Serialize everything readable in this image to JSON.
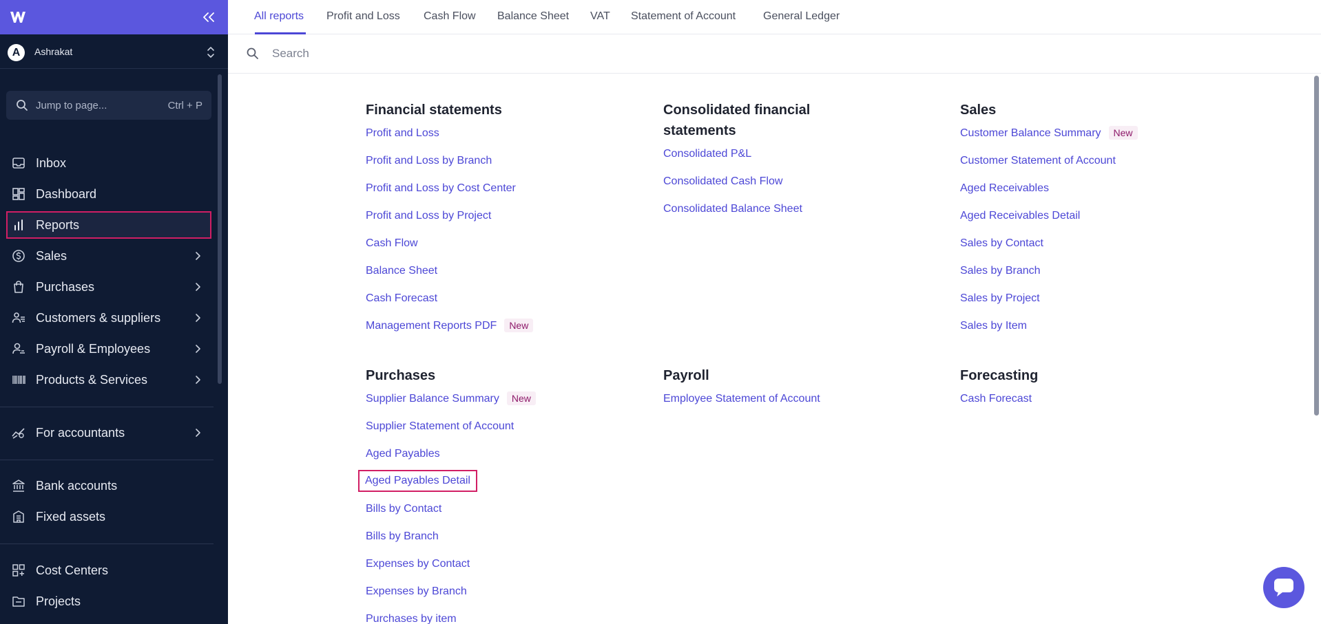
{
  "sidebar": {
    "org": {
      "initial": "A",
      "name": "Ashrakat"
    },
    "jump": {
      "label": "Jump to page...",
      "shortcut": "Ctrl + P"
    },
    "items": [
      {
        "label": "Inbox",
        "icon": "inbox-icon"
      },
      {
        "label": "Dashboard",
        "icon": "dashboard-icon"
      },
      {
        "label": "Reports",
        "icon": "bar-chart-icon",
        "active": true
      },
      {
        "label": "Sales",
        "icon": "dollar-circle-icon"
      },
      {
        "label": "Purchases",
        "icon": "shopping-bag-icon"
      },
      {
        "label": "Customers & suppliers",
        "icon": "users-icon"
      },
      {
        "label": "Payroll & Employees",
        "icon": "payroll-icon"
      },
      {
        "label": "Products & Services",
        "icon": "barcode-icon"
      },
      {
        "label": "For accountants",
        "icon": "trend-icon"
      },
      {
        "label": "Bank accounts",
        "icon": "bank-icon"
      },
      {
        "label": "Fixed assets",
        "icon": "building-icon"
      },
      {
        "label": "Cost Centers",
        "icon": "grid-icon"
      },
      {
        "label": "Projects",
        "icon": "folder-icon"
      }
    ]
  },
  "tabs": [
    "All reports",
    "Profit and Loss",
    "Cash Flow",
    "Balance Sheet",
    "VAT",
    "Statement of Account",
    "General Ledger"
  ],
  "search": {
    "placeholder": "Search"
  },
  "badge": "New",
  "sections": {
    "financial": {
      "title": "Financial statements",
      "links": [
        "Profit and Loss",
        "Profit and Loss by Branch",
        "Profit and Loss by Cost Center",
        "Profit and Loss by Project",
        "Cash Flow",
        "Balance Sheet",
        "Cash Forecast",
        "Management Reports PDF"
      ]
    },
    "consolidated": {
      "title": "Consolidated financial statements",
      "links": [
        "Consolidated P&L",
        "Consolidated Cash Flow",
        "Consolidated Balance Sheet"
      ]
    },
    "sales": {
      "title": "Sales",
      "links": [
        "Customer Balance Summary",
        "Customer Statement of Account",
        "Aged Receivables",
        "Aged Receivables Detail",
        "Sales by Contact",
        "Sales by Branch",
        "Sales by Project",
        "Sales by Item"
      ]
    },
    "purchases": {
      "title": "Purchases",
      "links": [
        "Supplier Balance Summary",
        "Supplier Statement of Account",
        "Aged Payables",
        "Aged Payables Detail",
        "Bills by Contact",
        "Bills by Branch",
        "Expenses by Contact",
        "Expenses by Branch",
        "Purchases by item"
      ]
    },
    "payroll": {
      "title": "Payroll",
      "links": [
        "Employee Statement of Account"
      ]
    },
    "forecasting": {
      "title": "Forecasting",
      "links": [
        "Cash Forecast"
      ]
    }
  },
  "colors": {
    "accent": "#4c47d6",
    "sidebar": "#0f1b33",
    "brand": "#5b57de",
    "highlight": "#d11e64"
  }
}
